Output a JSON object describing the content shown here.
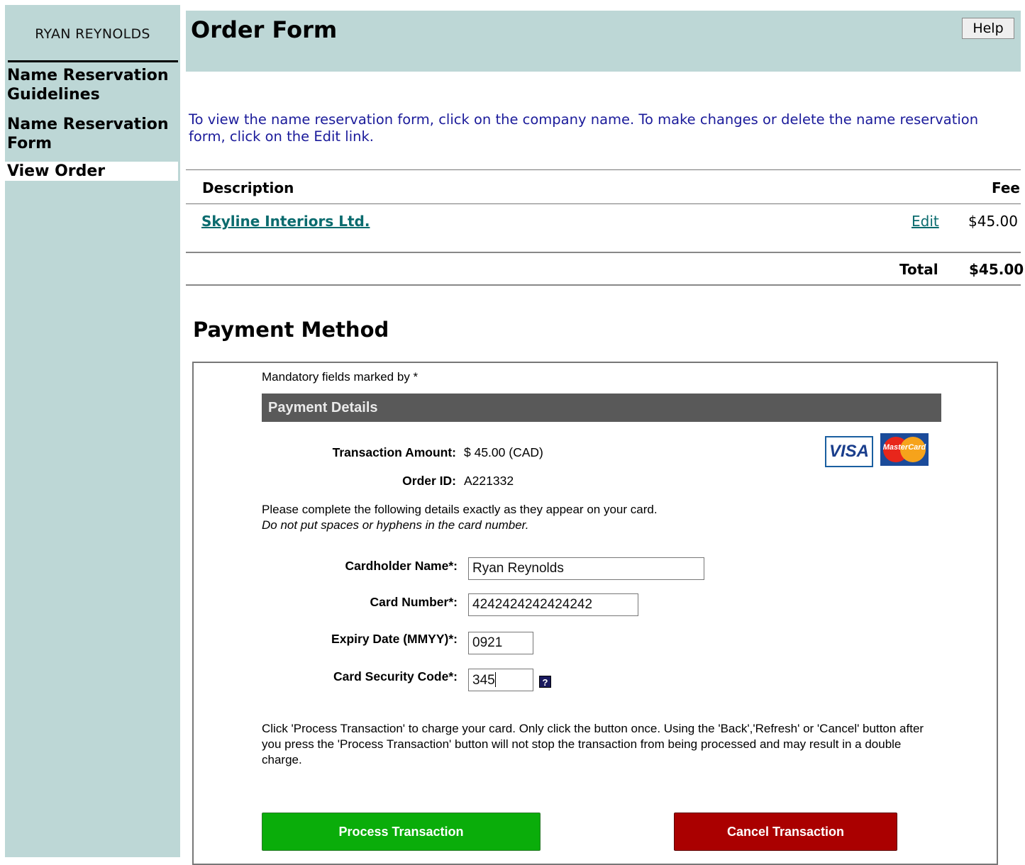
{
  "sidebar": {
    "user_name": "RYAN REYNOLDS",
    "items": [
      {
        "label": "Name Reservation Guidelines"
      },
      {
        "label": "Name Reservation Form"
      },
      {
        "label": "View Order"
      }
    ]
  },
  "header": {
    "title": "Order Form",
    "help_label": "Help"
  },
  "intro_text": "To view the name reservation form, click on the company name. To make changes or delete the name reservation form, click on the Edit link.",
  "order_table": {
    "col_description": "Description",
    "col_fee": "Fee",
    "rows": [
      {
        "company": "Skyline Interiors Ltd.",
        "edit_label": "Edit",
        "fee": "$45.00"
      }
    ],
    "total_label": "Total",
    "total_value": "$45.00"
  },
  "payment": {
    "section_title": "Payment Method",
    "mandatory_note": "Mandatory fields marked by *",
    "details_header": "Payment Details",
    "transaction_amount_label": "Transaction Amount:",
    "transaction_amount_value": "$ 45.00 (CAD)",
    "order_id_label": "Order ID:",
    "order_id_value": "A221332",
    "card_logos": [
      "VISA",
      "MasterCard"
    ],
    "instructions": "Please complete the following details exactly as they appear on your card.",
    "instructions_note": "Do not put spaces or hyphens in the card number.",
    "fields": {
      "cardholder_label": "Cardholder Name*:",
      "cardholder_value": "Ryan Reynolds",
      "card_number_label": "Card Number*:",
      "card_number_value": "4242424242424242",
      "expiry_label": "Expiry Date (MMYY)*:",
      "expiry_value": "0921",
      "cvc_label": "Card Security Code*:",
      "cvc_value": "345",
      "cvc_help_icon": "?"
    },
    "notice": "Click 'Process Transaction' to charge your card. Only click the button once. Using the 'Back','Refresh' or 'Cancel' button after you press the 'Process Transaction' button will not stop the transaction from being processed and may result in a double charge.",
    "process_button": "Process Transaction",
    "cancel_button": "Cancel Transaction"
  },
  "colors": {
    "panel_bg": "#bdd7d6",
    "link": "#0a6b6e",
    "intro_text": "#1a1a9a",
    "details_bar": "#595959",
    "process_btn": "#0aad0a",
    "cancel_btn": "#aa0000"
  }
}
